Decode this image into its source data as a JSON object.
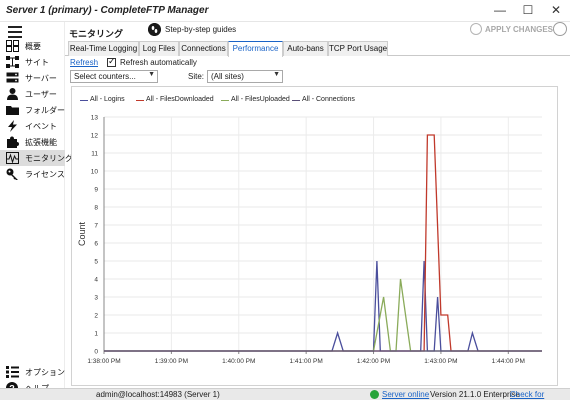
{
  "window": {
    "title": "Server 1 (primary) - CompleteFTP Manager",
    "controls": [
      "—",
      "☐",
      "✕"
    ]
  },
  "sidebar": {
    "menu_icon": "hamburger-icon",
    "items": [
      {
        "label": "概要",
        "icon": "dashboard-icon",
        "active": false
      },
      {
        "label": "サイト",
        "icon": "sitemap-icon",
        "active": false
      },
      {
        "label": "サーバー",
        "icon": "server-icon",
        "active": false
      },
      {
        "label": "ユーザー",
        "icon": "user-icon",
        "active": false
      },
      {
        "label": "フォルダー",
        "icon": "folder-icon",
        "active": false
      },
      {
        "label": "イベント",
        "icon": "lightning-icon",
        "active": false
      },
      {
        "label": "拡張機能",
        "icon": "puzzle-icon",
        "active": false
      },
      {
        "label": "モニタリング",
        "icon": "monitor-icon",
        "active": true
      },
      {
        "label": "ライセンス",
        "icon": "key-icon",
        "active": false
      }
    ],
    "bottom_items": [
      {
        "label": "オプション",
        "icon": "options-icon"
      },
      {
        "label": "ヘルプ",
        "icon": "help-icon"
      }
    ]
  },
  "header": {
    "page_title": "モニタリング",
    "step_guide_label": "Step-by-step guides",
    "apply_label": "APPLY CHANGES"
  },
  "tabs": [
    {
      "label": "Real-Time Logging",
      "active": false
    },
    {
      "label": "Log Files",
      "active": false
    },
    {
      "label": "Connections",
      "active": false
    },
    {
      "label": "Performance",
      "active": true
    },
    {
      "label": "Auto-bans",
      "active": false
    },
    {
      "label": "TCP Port Usage",
      "active": false
    }
  ],
  "toolbar": {
    "refresh_label": "Refresh",
    "refresh_auto_label": "Refresh automatically",
    "refresh_auto_checked": true,
    "counters_placeholder": "Select counters...",
    "site_label": "Site:",
    "site_value": "(All sites)"
  },
  "colors": {
    "accent": "#1a63c7",
    "logins": "#4a4e9c",
    "downloads": "#c0392b",
    "uploads": "#8aab5a",
    "connections": "#5a4f78",
    "status_ok": "#27a33a"
  },
  "chart_data": {
    "type": "line",
    "ylabel": "Count",
    "ylim": [
      0,
      13
    ],
    "yticks": [
      0,
      1,
      2,
      3,
      4,
      5,
      6,
      7,
      8,
      9,
      10,
      11,
      12,
      13
    ],
    "xlim": [
      "1:38:00 PM",
      "1:44:30 PM"
    ],
    "xticks": [
      "1:38:00 PM",
      "1:39:00 PM",
      "1:40:00 PM",
      "1:41:00 PM",
      "1:42:00 PM",
      "1:43:00 PM",
      "1:44:00 PM"
    ],
    "grid": true,
    "legend": "top-left",
    "series": [
      {
        "name": "All - Logins",
        "color": "#4a4e9c",
        "x": [
          "1:38:00 PM",
          "1:41:23 PM",
          "1:41:28 PM",
          "1:41:33 PM",
          "1:42:00 PM",
          "1:42:03 PM",
          "1:42:06 PM",
          "1:42:12 PM",
          "1:42:42 PM",
          "1:42:45 PM",
          "1:42:48 PM",
          "1:42:54 PM",
          "1:42:57 PM",
          "1:43:00 PM",
          "1:43:06 PM",
          "1:43:24 PM",
          "1:43:28 PM",
          "1:43:33 PM",
          "1:44:30 PM"
        ],
        "y": [
          0,
          0,
          1,
          0,
          0,
          5,
          0,
          0,
          0,
          5,
          0,
          0,
          3,
          0,
          0,
          0,
          1,
          0,
          0
        ]
      },
      {
        "name": "All - FilesDownloaded",
        "color": "#c0392b",
        "x": [
          "1:38:00 PM",
          "1:42:45 PM",
          "1:42:48 PM",
          "1:42:54 PM",
          "1:43:00 PM",
          "1:43:06 PM",
          "1:43:09 PM",
          "1:43:12 PM",
          "1:44:30 PM"
        ],
        "y": [
          0,
          0,
          12,
          12,
          2,
          2,
          0,
          0,
          0
        ]
      },
      {
        "name": "All - FilesUploaded",
        "color": "#8aab5a",
        "x": [
          "1:38:00 PM",
          "1:42:00 PM",
          "1:42:09 PM",
          "1:42:15 PM",
          "1:42:20 PM",
          "1:42:24 PM",
          "1:42:33 PM",
          "1:42:39 PM",
          "1:44:30 PM"
        ],
        "y": [
          0,
          0,
          3,
          0,
          0,
          4,
          0,
          0,
          0
        ]
      },
      {
        "name": "All - Connections",
        "color": "#5a4f78",
        "x": [
          "1:38:00 PM",
          "1:42:30 PM",
          "1:42:40 PM",
          "1:42:50 PM",
          "1:44:30 PM"
        ],
        "y": [
          0,
          0,
          0,
          0,
          0
        ]
      }
    ]
  },
  "status": {
    "user": "admin@localhost:14983 (Server 1)",
    "server_status": "Server online",
    "version": "Version 21.1.0 Enterprise",
    "updates_link": "Check for updates"
  }
}
